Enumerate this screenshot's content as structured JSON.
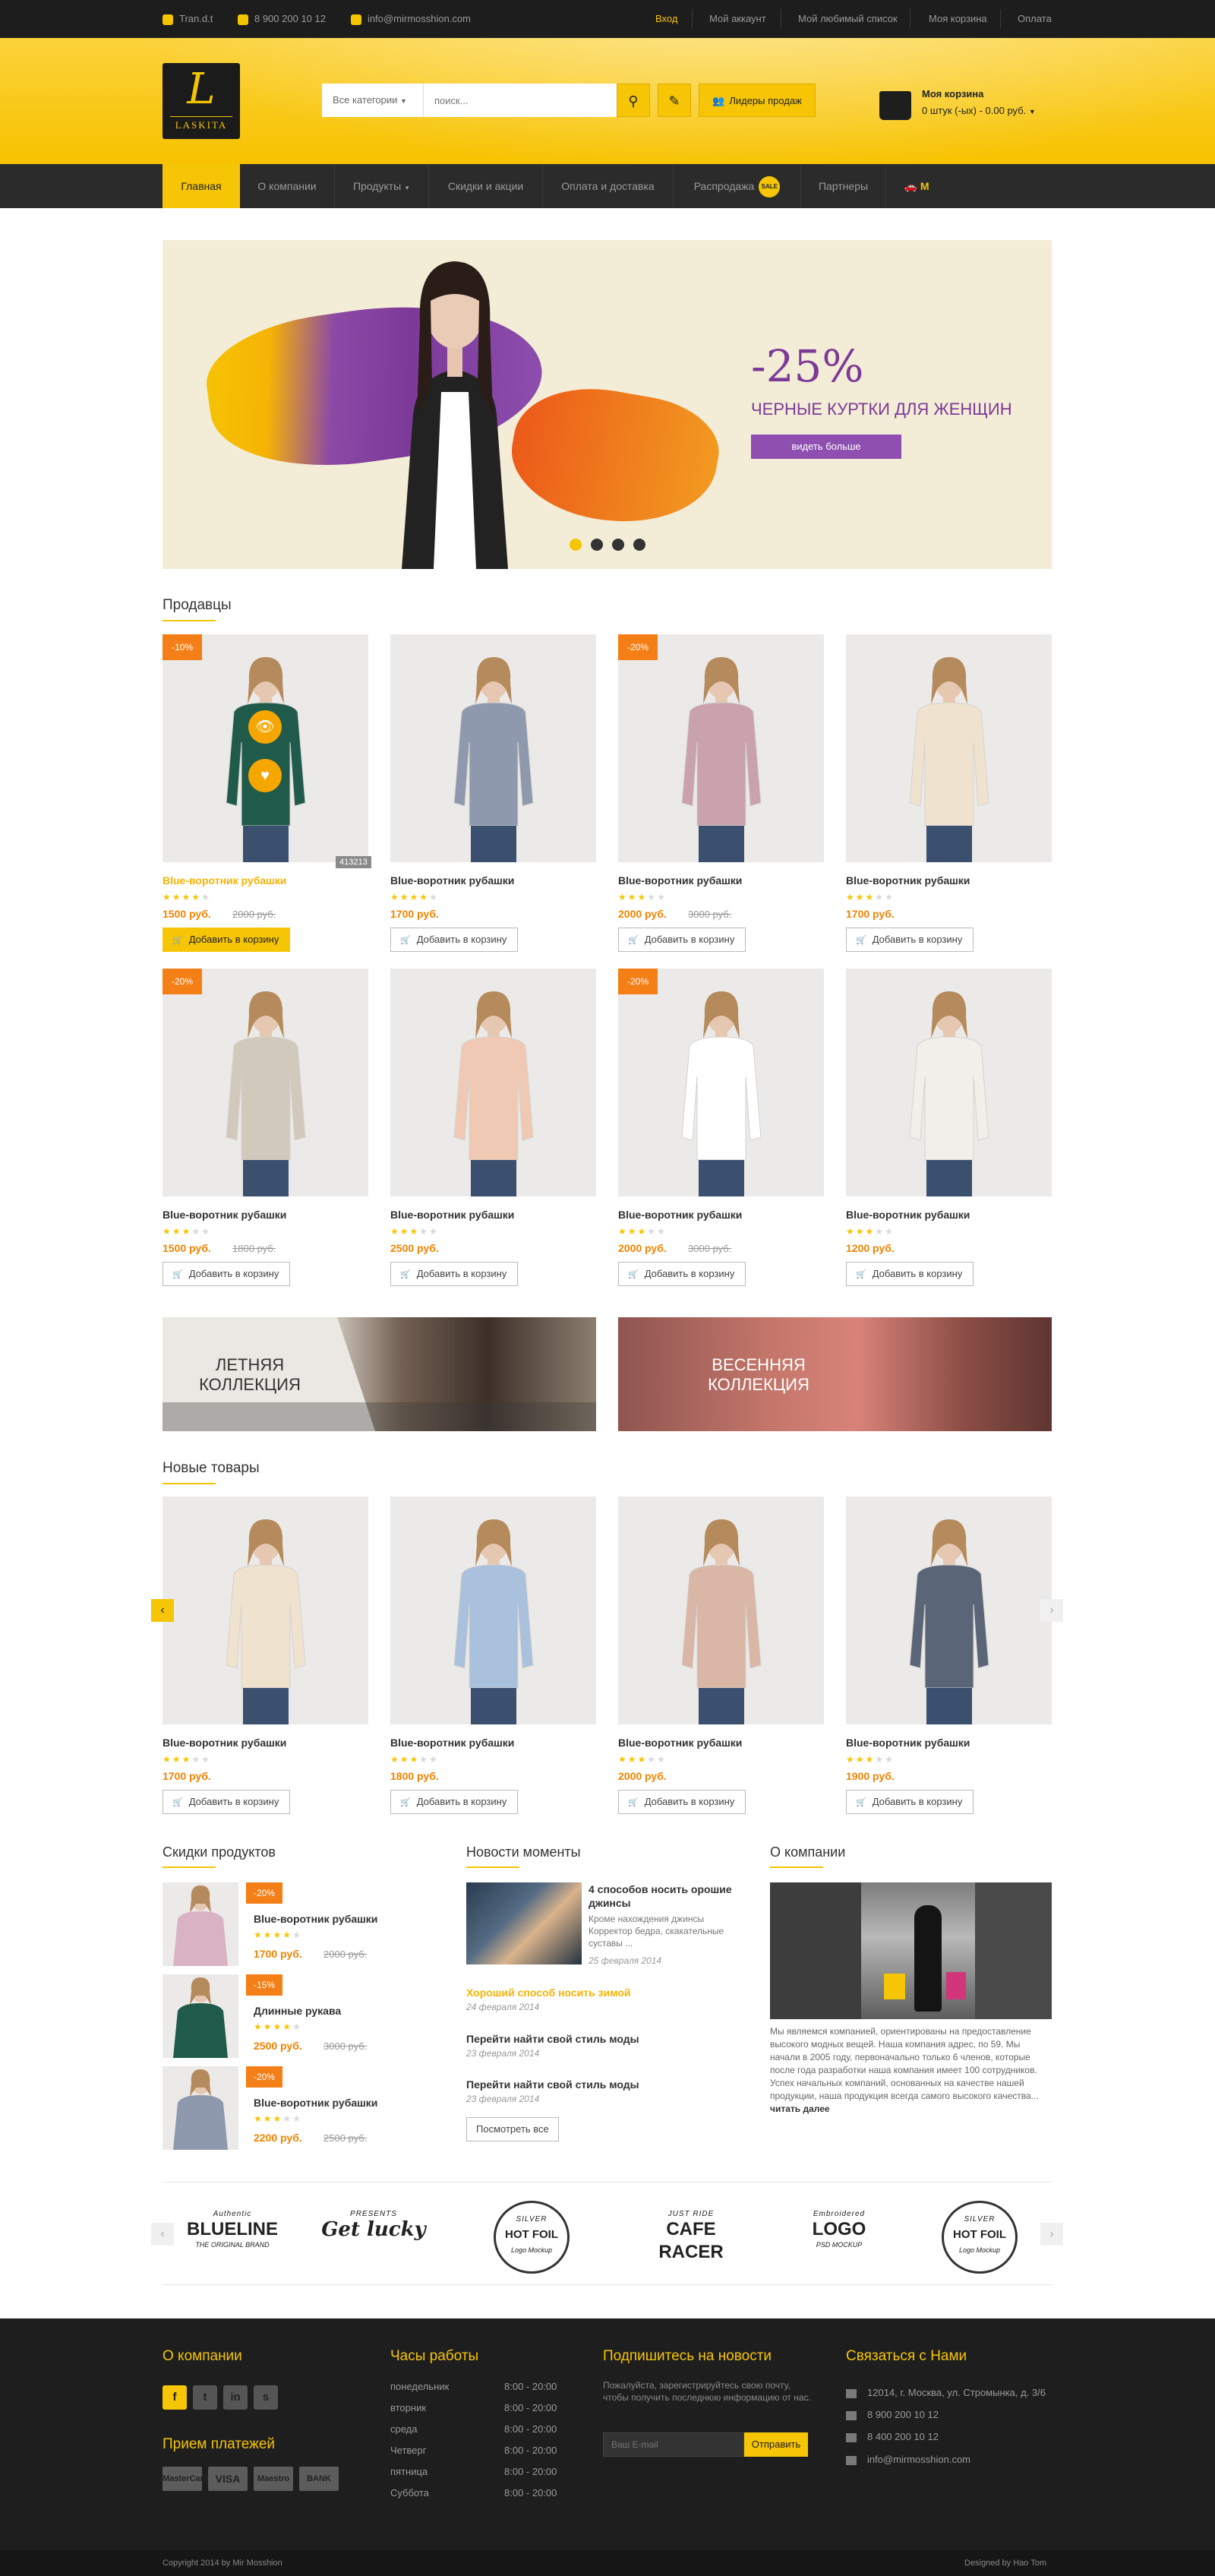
{
  "topbar": {
    "skype": "Tran.d.t",
    "phone": "8 900 200 10 12",
    "email": "info@mirmosshion.com",
    "links": [
      "Вход",
      "Мой аккаунт",
      "Мой любимый список",
      "Моя корзина",
      "Оплата"
    ]
  },
  "header": {
    "logo_letter": "L",
    "logo_text": "LASKITA",
    "category_select": "Все категории",
    "search_placeholder": "поиск...",
    "best_sellers": "Лидеры продаж",
    "cart_title": "Моя корзина",
    "cart_summary": "0 штук (-ых) - 0.00 руб."
  },
  "nav": {
    "items": [
      "Главная",
      "О компании",
      "Продукты",
      "Скидки и акции",
      "Оплата и доставка",
      "Распродажа",
      "Партнеры"
    ],
    "sale_badge": "SALE"
  },
  "hero": {
    "percent": "-25%",
    "caption": "ЧЕРНЫЕ КУРТКИ ДЛЯ ЖЕНЩИН",
    "button": "видеть больше",
    "slides": 4,
    "active_slide": 1,
    "colors": {
      "purple": "#7c3a98",
      "yellow": "#f6c505",
      "orange": "#ec5a1a"
    }
  },
  "sellers": {
    "title": "Продавцы",
    "tooltip": "413213",
    "products": [
      {
        "badge": "-10%",
        "name": "Blue-воротник рубашки",
        "rating": 4,
        "price": "1500 руб.",
        "old": "2000 руб.",
        "add": "Добавить в корзину",
        "shirt": "#1f5a4a"
      },
      {
        "badge": "",
        "name": "Blue-воротник рубашки",
        "rating": 4,
        "price": "1700 руб.",
        "old": "",
        "add": "Добавить в корзину",
        "shirt": "#8e99ad"
      },
      {
        "badge": "-20%",
        "name": "Blue-воротник рубашки",
        "rating": 3,
        "price": "2000 руб.",
        "old": "3000 руб.",
        "add": "Добавить в корзину",
        "shirt": "#c9a2ae"
      },
      {
        "badge": "",
        "name": "Blue-воротник рубашки",
        "rating": 3,
        "price": "1700 руб.",
        "old": "",
        "add": "Добавить в корзину",
        "shirt": "#efe3cf"
      },
      {
        "badge": "-20%",
        "name": "Blue-воротник рубашки",
        "rating": 3,
        "price": "1500 руб.",
        "old": "1800 руб.",
        "add": "Добавить в корзину",
        "shirt": "#d2c9bd"
      },
      {
        "badge": "",
        "name": "Blue-воротник рубашки",
        "rating": 3,
        "price": "2500 руб.",
        "old": "",
        "add": "Добавить в корзину",
        "shirt": "#f0c9b4"
      },
      {
        "badge": "-20%",
        "name": "Blue-воротник рубашки",
        "rating": 3,
        "price": "2000 руб.",
        "old": "3000 руб.",
        "add": "Добавить в корзину",
        "shirt": "#ffffff"
      },
      {
        "badge": "",
        "name": "Blue-воротник рубашки",
        "rating": 3,
        "price": "1200 руб.",
        "old": "",
        "add": "Добавить в корзину",
        "shirt": "#f2eee9"
      }
    ]
  },
  "promos": [
    {
      "line1": "ЛЕТНЯЯ",
      "line2": "КОЛЛЕКЦИЯ"
    },
    {
      "line1": "ВЕСЕННЯЯ",
      "line2": "КОЛЛЕКЦИЯ"
    }
  ],
  "new_products": {
    "title": "Новые товары",
    "items": [
      {
        "name": "Blue-воротник рубашки",
        "rating": 3,
        "price": "1700 руб.",
        "add": "Добавить в корзину",
        "shirt": "#efe3cf"
      },
      {
        "name": "Blue-воротник рубашки",
        "rating": 3,
        "price": "1800 руб.",
        "add": "Добавить в корзину",
        "shirt": "#a9c1dd"
      },
      {
        "name": "Blue-воротник рубашки",
        "rating": 3,
        "price": "2000 руб.",
        "add": "Добавить в корзину",
        "shirt": "#d9b6a6"
      },
      {
        "name": "Blue-воротник рубашки",
        "rating": 3,
        "price": "1900 руб.",
        "add": "Добавить в корзину",
        "shirt": "#5a6577"
      }
    ]
  },
  "discounts": {
    "title": "Скидки продуктов",
    "items": [
      {
        "badge": "-20%",
        "name": "Blue-воротник рубашки",
        "rating": 4,
        "price": "1700 руб.",
        "old": "2000 руб."
      },
      {
        "badge": "-15%",
        "name": "Длинные рукава",
        "rating": 4,
        "price": "2500 руб.",
        "old": "3000 руб."
      },
      {
        "badge": "-20%",
        "name": "Blue-воротник рубашки",
        "rating": 3,
        "price": "2200 руб.",
        "old": "2500 руб."
      }
    ]
  },
  "news": {
    "title": "Новости моменты",
    "featured_title": "4 способов носить орошие джинсы",
    "featured_text": "Кроме нахождения джинсы Корректор бедра, скакательные суставы ...",
    "featured_date": "25 февраля 2014",
    "items": [
      {
        "title": "Хороший способ носить зимой",
        "date": "24 февраля 2014"
      },
      {
        "title": "Перейти найти свой стиль моды",
        "date": "23 февраля 2014"
      },
      {
        "title": "Перейти найти свой стиль моды",
        "date": "23 февраля 2014"
      }
    ],
    "all": "Посмотреть все"
  },
  "about": {
    "title": "О компании",
    "text": "Мы являемся компанией, ориентированы на предоставление высокого модных вещей. Наша компания адрес, по 59. Мы начали в 2005 году, первоначально только 6 членов, которые после года разработки наша компания имеет 100 сотрудников. Успех начальных компаний, основанных на качестве нашей продукции, наша продукция всегда самого высокого качества...",
    "more": "читать далее"
  },
  "brands": [
    {
      "top": "Authentic",
      "main": "BLUELINE",
      "sub": "THE ORIGINAL BRAND"
    },
    {
      "top": "PRESENTS",
      "main": "Get lucky",
      "sub": ""
    },
    {
      "top": "SILVER",
      "main": "HOT FOIL",
      "sub": "Logo Mockup"
    },
    {
      "top": "JUST RIDE",
      "main": "CAFE RACER",
      "sub": ""
    },
    {
      "top": "Embroidered",
      "main": "LOGO",
      "sub": "PSD MOCKUP"
    },
    {
      "top": "SILVER",
      "main": "HOT FOIL",
      "sub": "Logo Mockup"
    }
  ],
  "footer": {
    "about_title": "О компании",
    "social": [
      "f",
      "t",
      "in",
      "s"
    ],
    "payments_title": "Прием платежей",
    "payments": [
      "MasterCard",
      "VISA",
      "Maestro",
      "BANK"
    ],
    "hours_title": "Часы работы",
    "hours": [
      {
        "day": "понедельник",
        "time": "8:00 - 20:00"
      },
      {
        "day": "вторник",
        "time": "8:00 - 20:00"
      },
      {
        "day": "среда",
        "time": "8:00 - 20:00"
      },
      {
        "day": "Четверг",
        "time": "8:00 - 20:00"
      },
      {
        "day": "пятница",
        "time": "8:00 - 20:00"
      },
      {
        "day": "Суббота",
        "time": "8:00 - 20:00"
      }
    ],
    "subscribe_title": "Подпишитесь на новости",
    "subscribe_text": "Пожалуйста, зарегистрируйтесь свою почту, чтобы получить последнюю информацию от нас.",
    "email_placeholder": "Ваш E-mail",
    "send": "Отправить",
    "contact_title": "Связаться с Нами",
    "contacts": [
      "12014, г. Москва, ул. Стромынка, д. 3/6",
      "8 900 200 10 12",
      "8 400 200 10 12",
      "info@mirmosshion.com"
    ],
    "copyright": "Copyright 2014 by Mir Mosshion",
    "designer": "Designed by Hao Tom"
  }
}
